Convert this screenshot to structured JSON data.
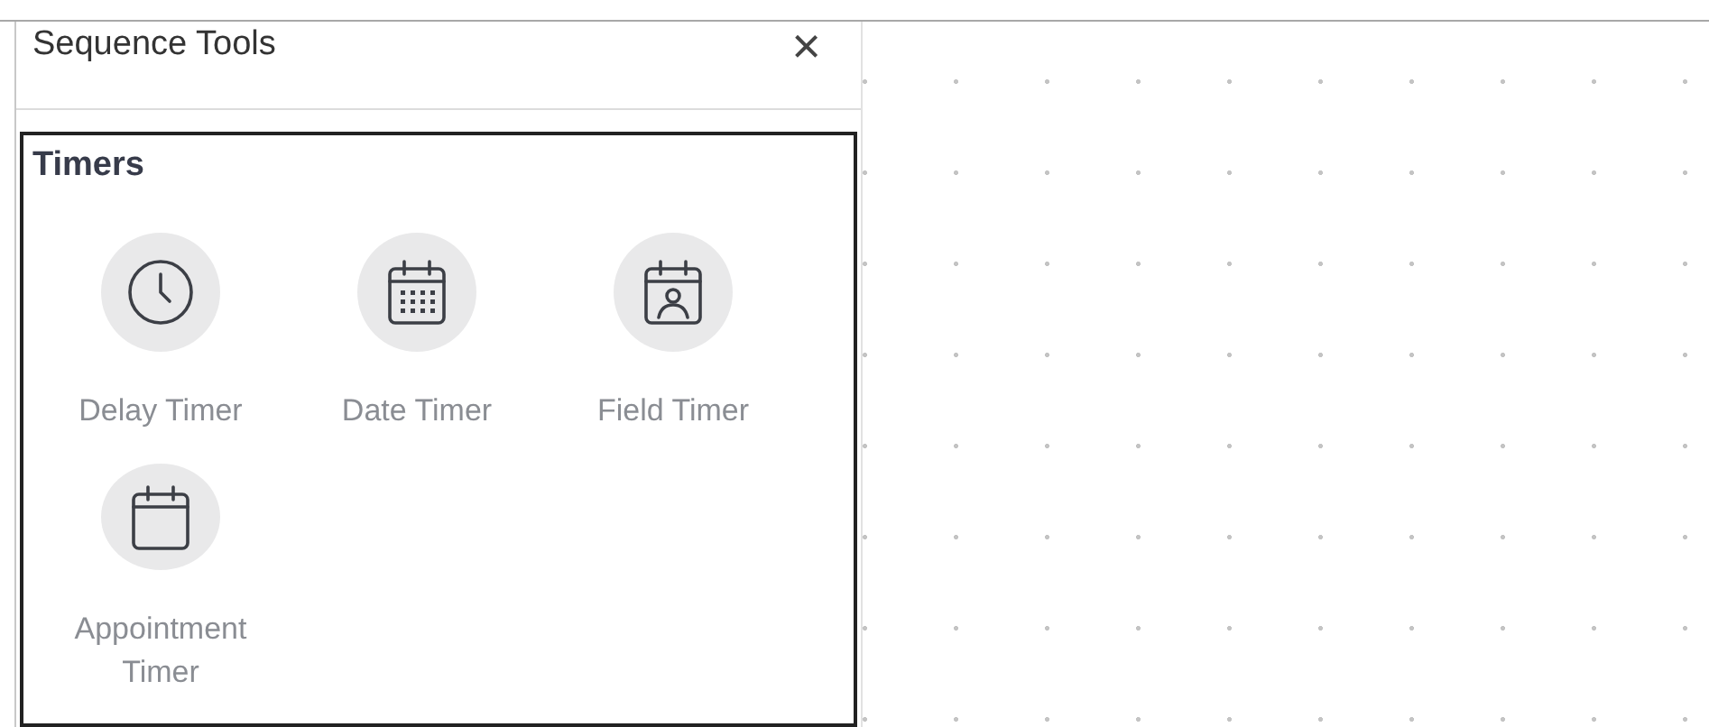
{
  "panel": {
    "title": "Sequence Tools",
    "close": "×"
  },
  "section": {
    "title": "Timers",
    "tools": [
      {
        "kind": "clock",
        "label": "Delay Timer"
      },
      {
        "kind": "calendar-grid",
        "label": "Date Timer"
      },
      {
        "kind": "calendar-person",
        "label": "Field Timer"
      },
      {
        "kind": "calendar",
        "label": "Appointment Timer"
      }
    ]
  }
}
